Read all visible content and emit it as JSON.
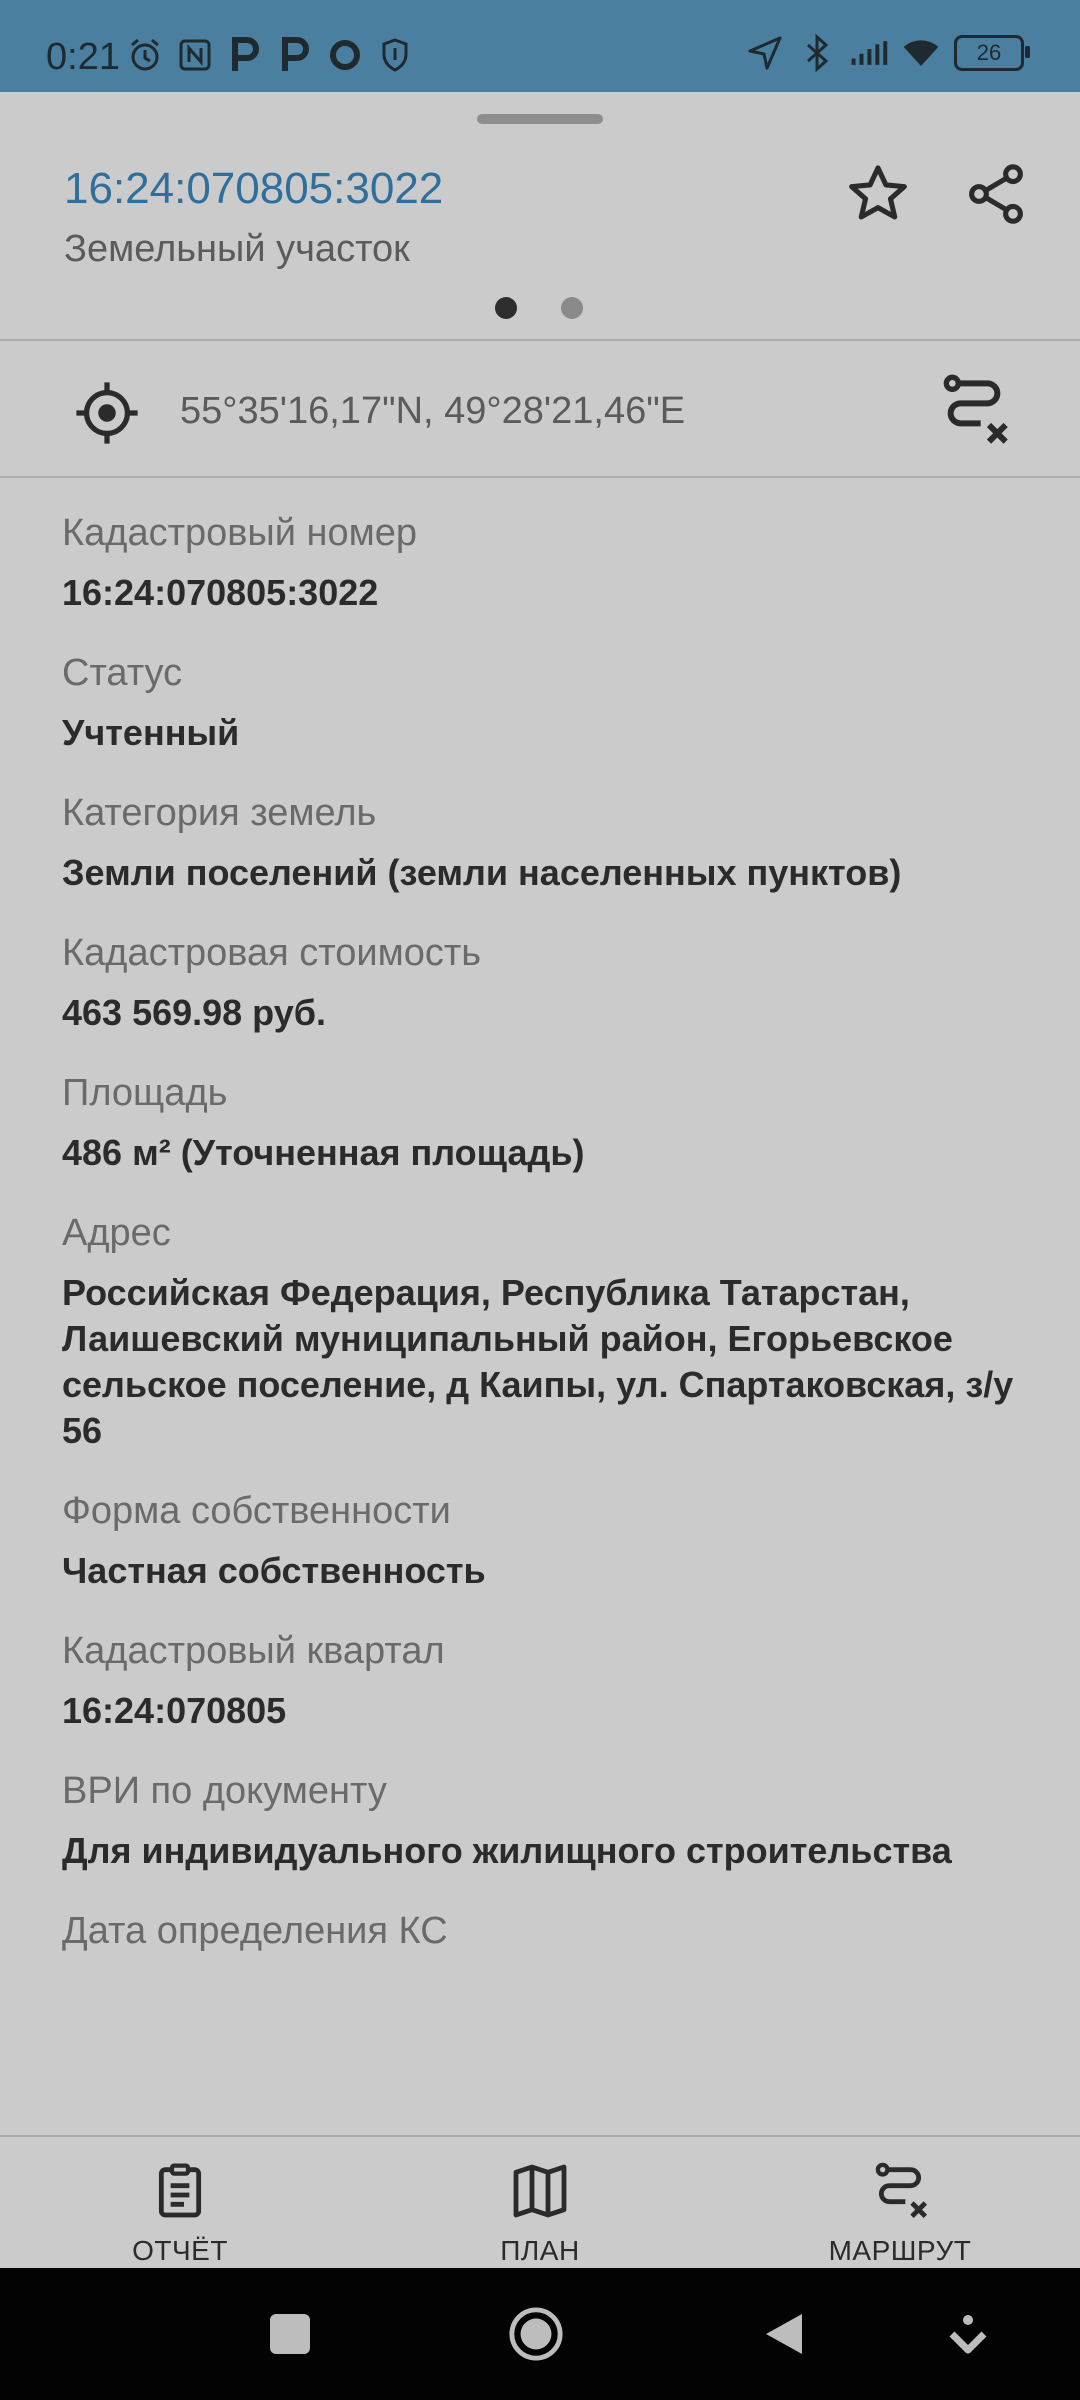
{
  "status_bar": {
    "time": "0:21",
    "battery": "26",
    "icons_left": [
      "alarm-icon",
      "nfc-icon",
      "p-icon",
      "p-icon",
      "circle-icon",
      "shield-icon"
    ],
    "icons_right": [
      "location-icon",
      "bluetooth-icon",
      "signal-icon",
      "wifi-icon",
      "battery-icon"
    ]
  },
  "header": {
    "title": "16:24:070805:3022",
    "subtitle": "Земельный участок",
    "page_dots": {
      "count": 2,
      "active_index": 0
    }
  },
  "coordinates": {
    "text": "55°35'16,17\"N, 49°28'21,46\"E"
  },
  "fields": [
    {
      "label": "Кадастровый номер",
      "value": "16:24:070805:3022"
    },
    {
      "label": "Статус",
      "value": "Учтенный"
    },
    {
      "label": "Категория земель",
      "value": "Земли поселений (земли населенных пунктов)"
    },
    {
      "label": "Кадастровая стоимость",
      "value": "463 569.98 руб."
    },
    {
      "label": "Площадь",
      "value": "486 м² (Уточненная площадь)"
    },
    {
      "label": "Адрес",
      "value": "Российская Федерация, Республика Татарстан, Лаишевский муниципальный район, Егорьевское сельское поселение, д Каипы, ул. Спартаковская, з/у 56"
    },
    {
      "label": "Форма собственности",
      "value": "Частная собственность"
    },
    {
      "label": "Кадастровый квартал",
      "value": "16:24:070805"
    },
    {
      "label": "ВРИ по документу",
      "value": "Для индивидуального жилищного строительства"
    },
    {
      "label": "Дата определения КС",
      "value": ""
    }
  ],
  "bottom_nav": [
    {
      "label": "ОТЧЁТ",
      "icon": "report-icon"
    },
    {
      "label": "ПЛАН",
      "icon": "map-icon"
    },
    {
      "label": "МАРШРУТ",
      "icon": "route-icon"
    }
  ],
  "colors": {
    "status_bar": "#4a7f9f",
    "background": "#cbcbcb",
    "title_accent": "#2f6f9c",
    "system_nav": "#030303"
  }
}
